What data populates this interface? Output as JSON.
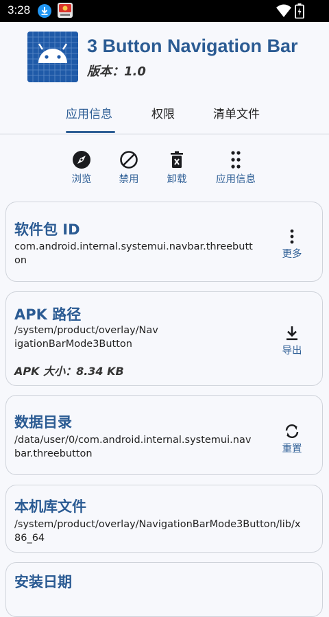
{
  "status_bar": {
    "time": "3:28"
  },
  "app": {
    "name": "3 Button Navigation Bar",
    "version": "版本：1.0"
  },
  "tabs": [
    {
      "label": "应用信息",
      "active": true
    },
    {
      "label": "权限",
      "active": false
    },
    {
      "label": "清单文件",
      "active": false
    }
  ],
  "actions": [
    {
      "label": "浏览",
      "icon": "compass-icon"
    },
    {
      "label": "禁用",
      "icon": "block-icon"
    },
    {
      "label": "卸载",
      "icon": "trash-icon"
    },
    {
      "label": "应用信息",
      "icon": "grid-dots-icon"
    }
  ],
  "cards": {
    "package": {
      "title": "软件包 ID",
      "value": "com.android.internal.systemui.navbar.threebutton",
      "button": "更多"
    },
    "apk": {
      "title": "APK 路径",
      "value": "/system/product/overlay/NavigationBarMode3Button",
      "size": "APK 大小：8.34 KB",
      "button": "导出"
    },
    "data_dir": {
      "title": "数据目录",
      "value": "/data/user/0/com.android.internal.systemui.navbar.threebutton",
      "button": "重置"
    },
    "native_lib": {
      "title": "本机库文件",
      "value": "/system/product/overlay/NavigationBarMode3Button/lib/x86_64"
    },
    "install_date": {
      "title": "安装日期"
    }
  },
  "colors": {
    "accent": "#2f5f96",
    "title": "#2b5b93",
    "logo_bg": "#1f5aa8"
  }
}
